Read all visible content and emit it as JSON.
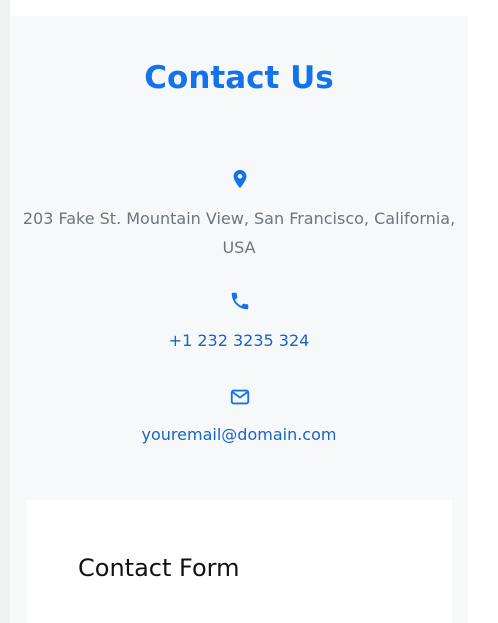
{
  "contact": {
    "title": "Contact Us",
    "address": "203 Fake St. Mountain View, San Francisco, California, USA",
    "phone": "+1 232 3235 324",
    "email": "youremail@domain.com"
  },
  "form": {
    "title": "Contact Form"
  },
  "icons": {
    "address": "map-pin-icon",
    "phone": "phone-icon",
    "email": "mail-icon"
  },
  "colors": {
    "accent": "#1273eb",
    "link": "#1a63c6",
    "text_muted": "#6c757d"
  }
}
